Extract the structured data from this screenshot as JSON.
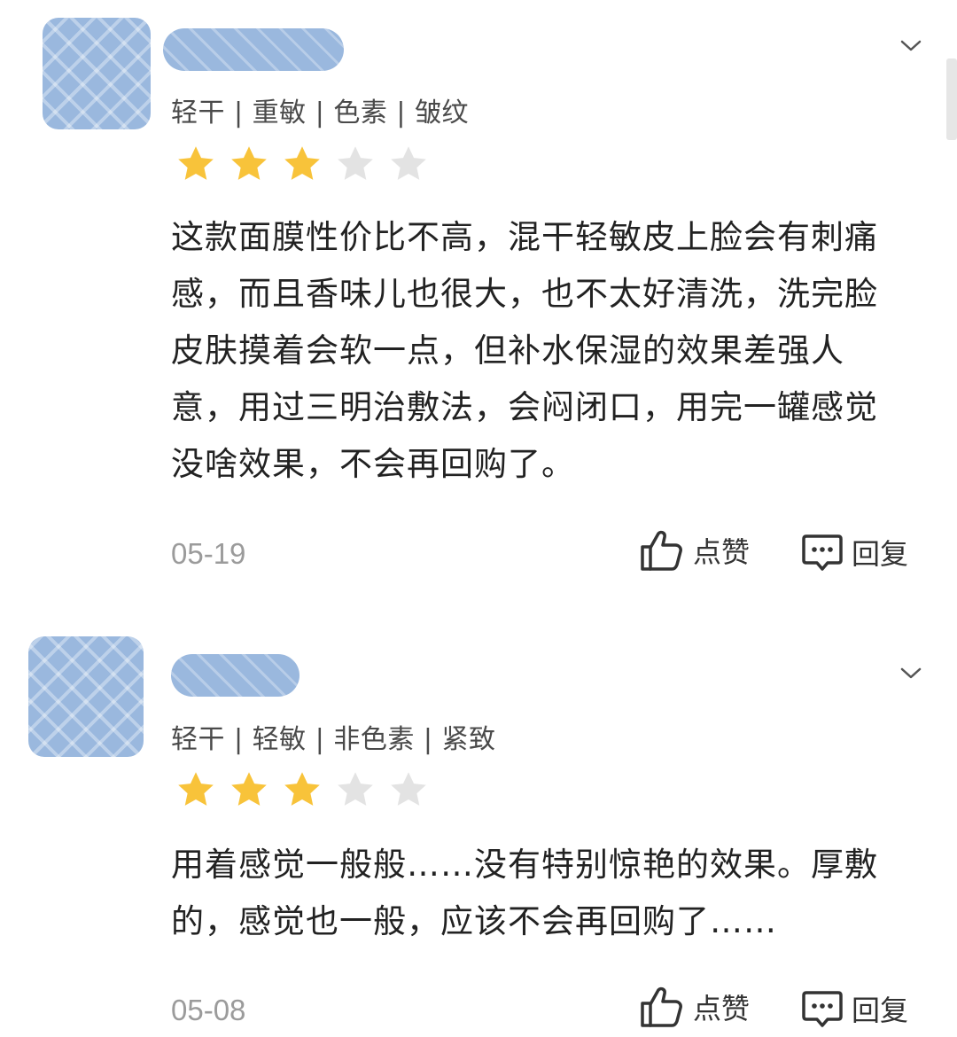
{
  "colors": {
    "star_filled": "#F8C33A",
    "star_empty": "#E3E3E3",
    "date": "#9B9B9B",
    "avatar_blur": "#9AB8DE"
  },
  "reviews": [
    {
      "tags": "轻干 | 重敏 | 色素 | 皱纹",
      "rating": 3,
      "rating_max": 5,
      "content": "这款面膜性价比不高，混干轻敏皮上脸会有刺痛感，而且香味儿也很大，也不太好清洗，洗完脸皮肤摸着会软一点，但补水保湿的效果差强人意，用过三明治敷法，会闷闭口，用完一罐感觉没啥效果，不会再回购了。",
      "date": "05-19",
      "like_label": "点赞",
      "reply_label": "回复",
      "like_icon": "thumbs-up-icon",
      "reply_icon": "comment-icon",
      "expand_icon": "chevron-down-icon"
    },
    {
      "tags": "轻干 | 轻敏 | 非色素 | 紧致",
      "rating": 3,
      "rating_max": 5,
      "content": "用着感觉一般般……没有特别惊艳的效果。厚敷的，感觉也一般，应该不会再回购了……",
      "date": "05-08",
      "like_label": "点赞",
      "reply_label": "回复",
      "like_icon": "thumbs-up-icon",
      "reply_icon": "comment-icon",
      "expand_icon": "chevron-down-icon"
    }
  ]
}
